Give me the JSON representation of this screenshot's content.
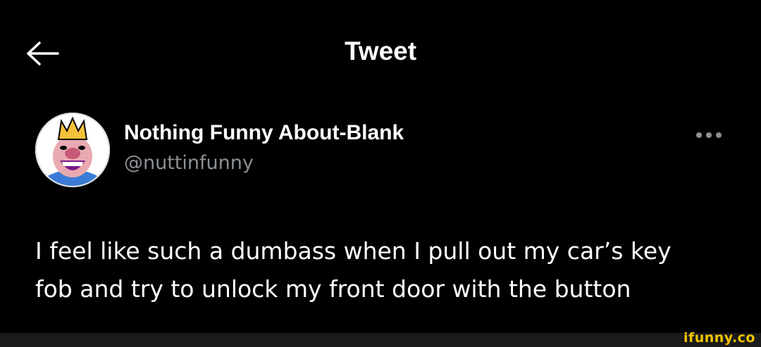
{
  "header": {
    "title": "Tweet",
    "back_icon": "arrow-left-icon"
  },
  "tweet": {
    "author": {
      "display_name": "Nothing Funny About-Blank",
      "handle": "@nuttinfunny",
      "avatar_icon": "king-emote-avatar"
    },
    "more_icon": "more-horizontal-icon",
    "text": "I feel like such a dumbass when I pull out my car’s key\nfob and try to unlock my front door with the button"
  },
  "watermark": {
    "text": "ifunny.co",
    "color": "#f2c400"
  },
  "colors": {
    "background": "#000000",
    "primary_text": "#ffffff",
    "secondary_text": "#8b9096"
  }
}
